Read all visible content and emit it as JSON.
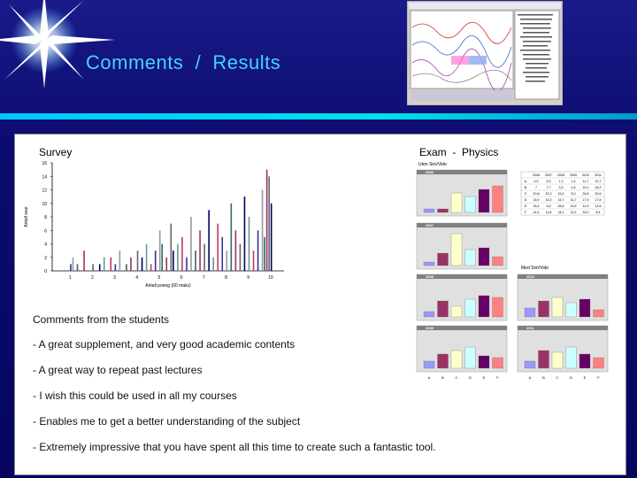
{
  "slide_title": "Comments  /  Results",
  "survey_label": "Survey",
  "exam_label": "Exam  -  Physics",
  "comments": {
    "heading": "Comments from the students",
    "items": [
      "- A great supplement, and very good academic contents",
      "- A great way to repeat past lectures",
      "- I wish this could be used in all my courses",
      "- Enables me to get a better understanding of the subject",
      "- Extremely impressive that you have spent all this time to create such a fantastic tool."
    ]
  },
  "colors": {
    "title": "#3fd4ff",
    "divider": "#00c8ff",
    "bar_blue": "#9999ff",
    "bar_maroon": "#993366",
    "bar_cream": "#ffffcc",
    "bar_lightblue": "#ccffff",
    "bar_purple": "#660066",
    "bar_salmon": "#ff8080"
  },
  "chart_data": [
    {
      "type": "bar",
      "xlabel": "Antall poeng (60 maks)",
      "ylabel": "Antall svar",
      "ylim": [
        0,
        16
      ],
      "yticks": [
        0,
        2,
        4,
        6,
        8,
        10,
        12,
        14,
        16
      ],
      "xticks": [
        1,
        2,
        3,
        4,
        5,
        6,
        7,
        8,
        9,
        10
      ],
      "x": [
        1.0,
        1.1,
        1.3,
        1.6,
        2.0,
        2.3,
        2.5,
        2.8,
        3.0,
        3.2,
        3.5,
        3.7,
        4.0,
        4.2,
        4.4,
        4.6,
        4.8,
        5.0,
        5.1,
        5.3,
        5.5,
        5.6,
        5.8,
        6.0,
        6.2,
        6.4,
        6.6,
        6.8,
        7.0,
        7.2,
        7.4,
        7.6,
        7.8,
        8.0,
        8.2,
        8.4,
        8.6,
        8.8,
        9.0,
        9.2,
        9.4,
        9.6,
        9.7,
        9.8,
        9.9,
        10.0
      ],
      "values": [
        1,
        2,
        1,
        3,
        1,
        1,
        2,
        2,
        1,
        3,
        1,
        2,
        3,
        2,
        4,
        1,
        3,
        6,
        4,
        2,
        7,
        3,
        4,
        5,
        2,
        8,
        3,
        6,
        4,
        9,
        2,
        7,
        5,
        3,
        10,
        6,
        4,
        11,
        8,
        3,
        6,
        12,
        5,
        15,
        14,
        10
      ]
    },
    {
      "type": "bar",
      "title": "Uten Sim/Vide",
      "categories": [
        "A",
        "B",
        "C",
        "D",
        "E",
        "F"
      ],
      "panels": [
        {
          "label": "2006",
          "values": [
            2,
            2,
            11,
            9,
            13,
            15
          ]
        },
        {
          "label": "2007",
          "values": [
            2,
            7,
            18,
            9,
            10,
            5
          ]
        },
        {
          "label": "2008",
          "values": [
            3,
            9,
            6,
            10,
            12,
            11
          ]
        },
        {
          "label": "2009",
          "values": [
            4,
            8,
            10,
            12,
            7,
            6
          ]
        },
        {
          "label": "2010",
          "values": [
            5,
            9,
            11,
            8,
            10,
            4
          ]
        },
        {
          "label": "2011",
          "values": [
            4,
            10,
            9,
            12,
            8,
            6
          ]
        }
      ]
    },
    {
      "type": "table",
      "title": "Med Sim/Vide",
      "columns": [
        "",
        "2006",
        "2007",
        "2008",
        "2009",
        "2010",
        "2011"
      ],
      "rows": [
        [
          "A",
          "4,5",
          "5,5",
          "1,3",
          "1,4",
          "11,7",
          "10,7"
        ],
        [
          "B",
          "7",
          "7,7",
          "3,3",
          "4,6",
          "15,1",
          "16,3"
        ],
        [
          "C",
          "20,8",
          "20,3",
          "16,4",
          "5,0",
          "26,8",
          "30,6"
        ],
        [
          "D",
          "16,9",
          "15,3",
          "15,7",
          "31,7",
          "17,9",
          "17,8"
        ],
        [
          "E",
          "18,4",
          "5,8",
          "28,6",
          "24,5",
          "12,9",
          "12,6"
        ],
        [
          "F",
          "14,4",
          "11,8",
          "18,1",
          "11,9",
          "18,2",
          "8,4"
        ]
      ]
    }
  ]
}
